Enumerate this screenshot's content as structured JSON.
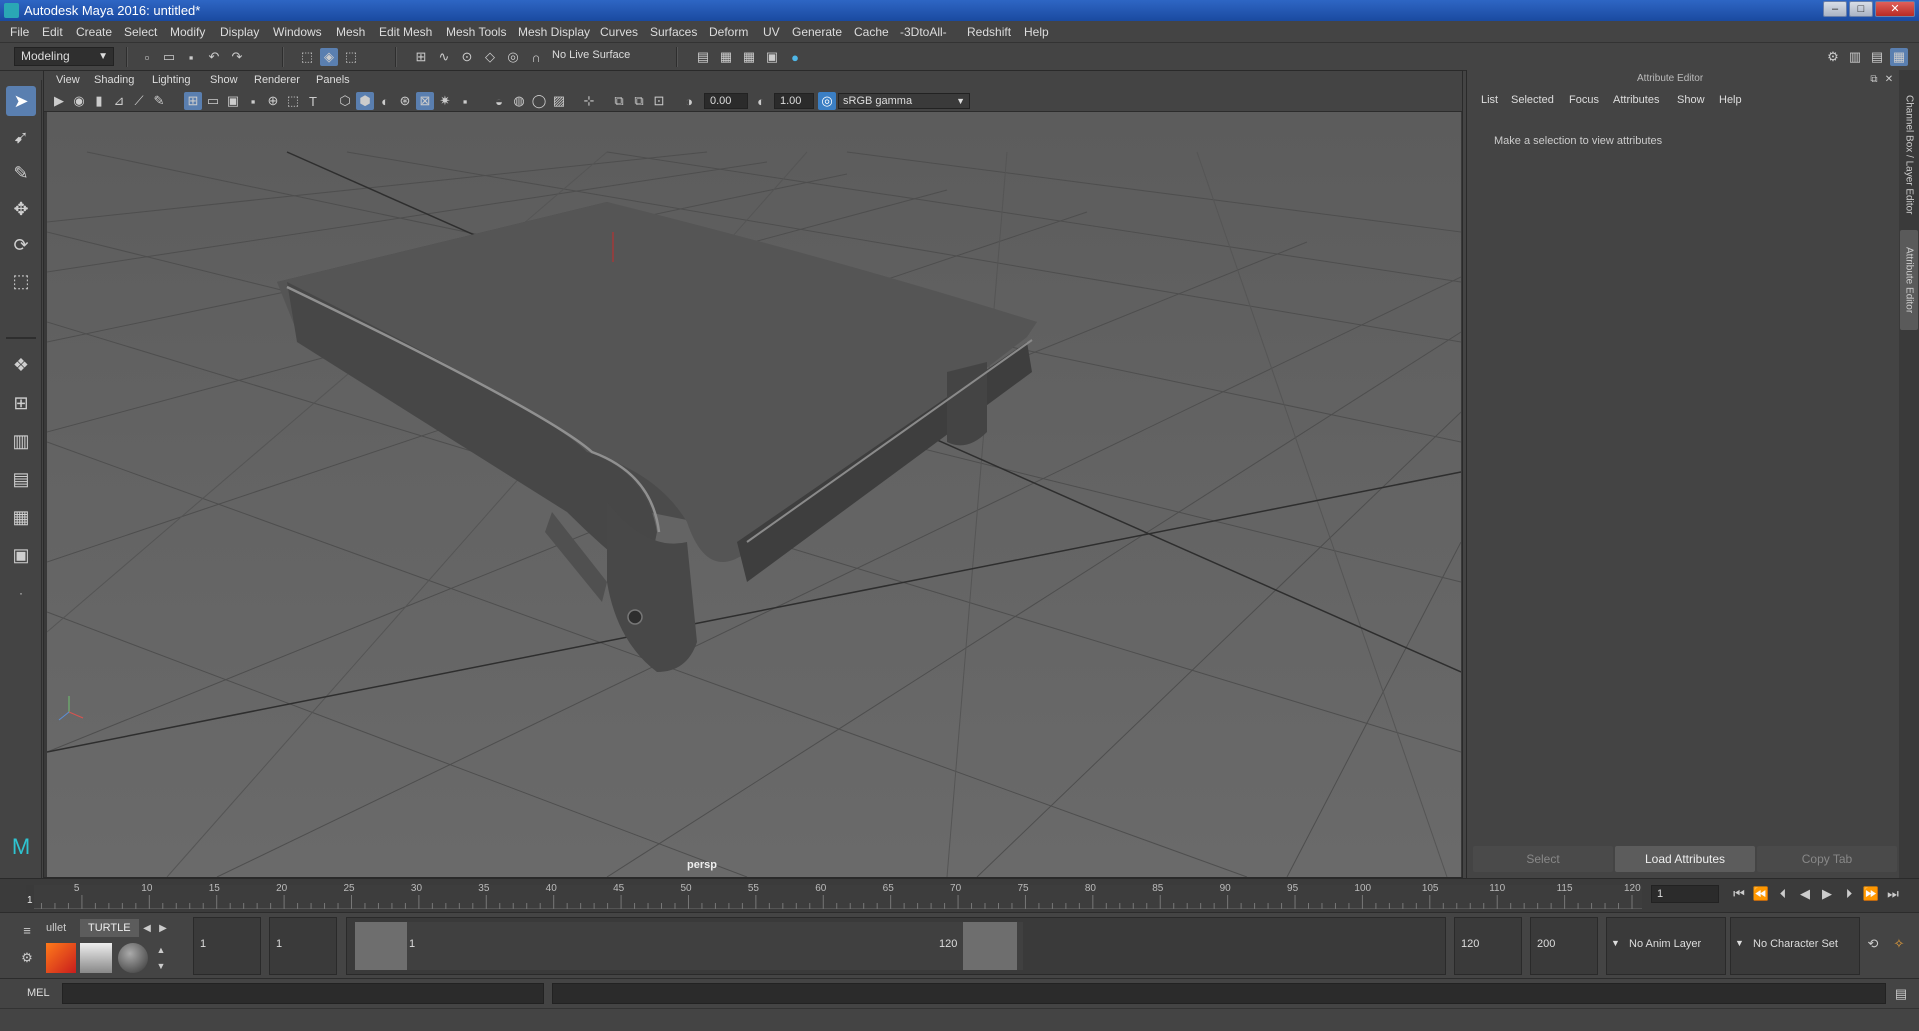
{
  "window": {
    "title": "Autodesk Maya 2016: untitled*",
    "min": "–",
    "max": "□",
    "close": "✕"
  },
  "menus": [
    "File",
    "Edit",
    "Create",
    "Select",
    "Modify",
    "Display",
    "Windows",
    "Mesh",
    "Edit Mesh",
    "Mesh Tools",
    "Mesh Display",
    "Curves",
    "Surfaces",
    "Deform",
    "UV",
    "Generate",
    "Cache",
    "-3DtoAll-",
    "Redshift",
    "Help"
  ],
  "shelf": {
    "mode": "Modeling",
    "live_surface": "No Live Surface"
  },
  "viewport": {
    "menus": [
      "View",
      "Shading",
      "Lighting",
      "Show",
      "Renderer",
      "Panels"
    ],
    "exposure": "0.00",
    "gamma": "1.00",
    "color_space": "sRGB gamma",
    "camera_label": "persp"
  },
  "attribute_editor": {
    "title": "Attribute Editor",
    "menus": [
      "List",
      "Selected",
      "Focus",
      "Attributes",
      "Show",
      "Help"
    ],
    "message": "Make a selection to view attributes",
    "buttons": {
      "select": "Select",
      "load": "Load Attributes",
      "copy": "Copy Tab"
    }
  },
  "side_tabs": {
    "channel_box": "Channel Box / Layer Editor",
    "attribute_editor": "Attribute Editor"
  },
  "timeline": {
    "ticks": [
      "5",
      "10",
      "15",
      "20",
      "25",
      "30",
      "35",
      "40",
      "45",
      "50",
      "55",
      "60",
      "65",
      "70",
      "75",
      "80",
      "85",
      "90",
      "95",
      "100",
      "105",
      "110",
      "115",
      "120"
    ],
    "start_tick": "1",
    "current_frame": "1"
  },
  "range": {
    "shelf_tabs": [
      "ullet",
      "TURTLE"
    ],
    "start_field": "1",
    "playback_start": "1",
    "range_start_label": "1",
    "range_end_label": "120",
    "playback_end": "120",
    "end_field": "200",
    "anim_layer": "No Anim Layer",
    "character_set": "No Character Set"
  },
  "cmdline": {
    "label": "MEL"
  },
  "colors": {
    "accent": "#4f8fd8",
    "ui_bg": "#444444",
    "viewport_bg": "#636363"
  }
}
